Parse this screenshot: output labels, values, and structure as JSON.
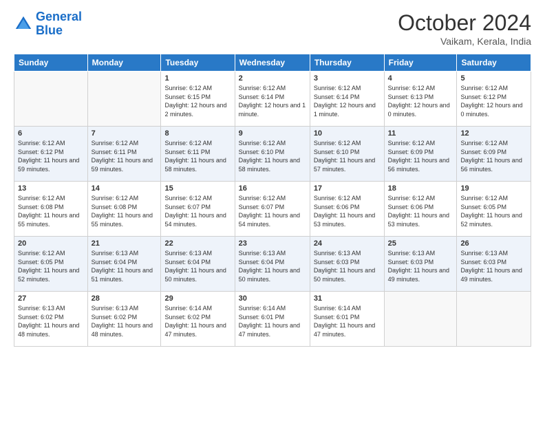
{
  "header": {
    "logo_line1": "General",
    "logo_line2": "Blue",
    "month_title": "October 2024",
    "subtitle": "Vaikam, Kerala, India"
  },
  "days_of_week": [
    "Sunday",
    "Monday",
    "Tuesday",
    "Wednesday",
    "Thursday",
    "Friday",
    "Saturday"
  ],
  "weeks": [
    [
      {
        "num": "",
        "info": ""
      },
      {
        "num": "",
        "info": ""
      },
      {
        "num": "1",
        "info": "Sunrise: 6:12 AM\nSunset: 6:15 PM\nDaylight: 12 hours\nand 2 minutes."
      },
      {
        "num": "2",
        "info": "Sunrise: 6:12 AM\nSunset: 6:14 PM\nDaylight: 12 hours\nand 1 minute."
      },
      {
        "num": "3",
        "info": "Sunrise: 6:12 AM\nSunset: 6:14 PM\nDaylight: 12 hours\nand 1 minute."
      },
      {
        "num": "4",
        "info": "Sunrise: 6:12 AM\nSunset: 6:13 PM\nDaylight: 12 hours\nand 0 minutes."
      },
      {
        "num": "5",
        "info": "Sunrise: 6:12 AM\nSunset: 6:12 PM\nDaylight: 12 hours\nand 0 minutes."
      }
    ],
    [
      {
        "num": "6",
        "info": "Sunrise: 6:12 AM\nSunset: 6:12 PM\nDaylight: 11 hours\nand 59 minutes."
      },
      {
        "num": "7",
        "info": "Sunrise: 6:12 AM\nSunset: 6:11 PM\nDaylight: 11 hours\nand 59 minutes."
      },
      {
        "num": "8",
        "info": "Sunrise: 6:12 AM\nSunset: 6:11 PM\nDaylight: 11 hours\nand 58 minutes."
      },
      {
        "num": "9",
        "info": "Sunrise: 6:12 AM\nSunset: 6:10 PM\nDaylight: 11 hours\nand 58 minutes."
      },
      {
        "num": "10",
        "info": "Sunrise: 6:12 AM\nSunset: 6:10 PM\nDaylight: 11 hours\nand 57 minutes."
      },
      {
        "num": "11",
        "info": "Sunrise: 6:12 AM\nSunset: 6:09 PM\nDaylight: 11 hours\nand 56 minutes."
      },
      {
        "num": "12",
        "info": "Sunrise: 6:12 AM\nSunset: 6:09 PM\nDaylight: 11 hours\nand 56 minutes."
      }
    ],
    [
      {
        "num": "13",
        "info": "Sunrise: 6:12 AM\nSunset: 6:08 PM\nDaylight: 11 hours\nand 55 minutes."
      },
      {
        "num": "14",
        "info": "Sunrise: 6:12 AM\nSunset: 6:08 PM\nDaylight: 11 hours\nand 55 minutes."
      },
      {
        "num": "15",
        "info": "Sunrise: 6:12 AM\nSunset: 6:07 PM\nDaylight: 11 hours\nand 54 minutes."
      },
      {
        "num": "16",
        "info": "Sunrise: 6:12 AM\nSunset: 6:07 PM\nDaylight: 11 hours\nand 54 minutes."
      },
      {
        "num": "17",
        "info": "Sunrise: 6:12 AM\nSunset: 6:06 PM\nDaylight: 11 hours\nand 53 minutes."
      },
      {
        "num": "18",
        "info": "Sunrise: 6:12 AM\nSunset: 6:06 PM\nDaylight: 11 hours\nand 53 minutes."
      },
      {
        "num": "19",
        "info": "Sunrise: 6:12 AM\nSunset: 6:05 PM\nDaylight: 11 hours\nand 52 minutes."
      }
    ],
    [
      {
        "num": "20",
        "info": "Sunrise: 6:12 AM\nSunset: 6:05 PM\nDaylight: 11 hours\nand 52 minutes."
      },
      {
        "num": "21",
        "info": "Sunrise: 6:13 AM\nSunset: 6:04 PM\nDaylight: 11 hours\nand 51 minutes."
      },
      {
        "num": "22",
        "info": "Sunrise: 6:13 AM\nSunset: 6:04 PM\nDaylight: 11 hours\nand 50 minutes."
      },
      {
        "num": "23",
        "info": "Sunrise: 6:13 AM\nSunset: 6:04 PM\nDaylight: 11 hours\nand 50 minutes."
      },
      {
        "num": "24",
        "info": "Sunrise: 6:13 AM\nSunset: 6:03 PM\nDaylight: 11 hours\nand 50 minutes."
      },
      {
        "num": "25",
        "info": "Sunrise: 6:13 AM\nSunset: 6:03 PM\nDaylight: 11 hours\nand 49 minutes."
      },
      {
        "num": "26",
        "info": "Sunrise: 6:13 AM\nSunset: 6:03 PM\nDaylight: 11 hours\nand 49 minutes."
      }
    ],
    [
      {
        "num": "27",
        "info": "Sunrise: 6:13 AM\nSunset: 6:02 PM\nDaylight: 11 hours\nand 48 minutes."
      },
      {
        "num": "28",
        "info": "Sunrise: 6:13 AM\nSunset: 6:02 PM\nDaylight: 11 hours\nand 48 minutes."
      },
      {
        "num": "29",
        "info": "Sunrise: 6:14 AM\nSunset: 6:02 PM\nDaylight: 11 hours\nand 47 minutes."
      },
      {
        "num": "30",
        "info": "Sunrise: 6:14 AM\nSunset: 6:01 PM\nDaylight: 11 hours\nand 47 minutes."
      },
      {
        "num": "31",
        "info": "Sunrise: 6:14 AM\nSunset: 6:01 PM\nDaylight: 11 hours\nand 47 minutes."
      },
      {
        "num": "",
        "info": ""
      },
      {
        "num": "",
        "info": ""
      }
    ]
  ]
}
